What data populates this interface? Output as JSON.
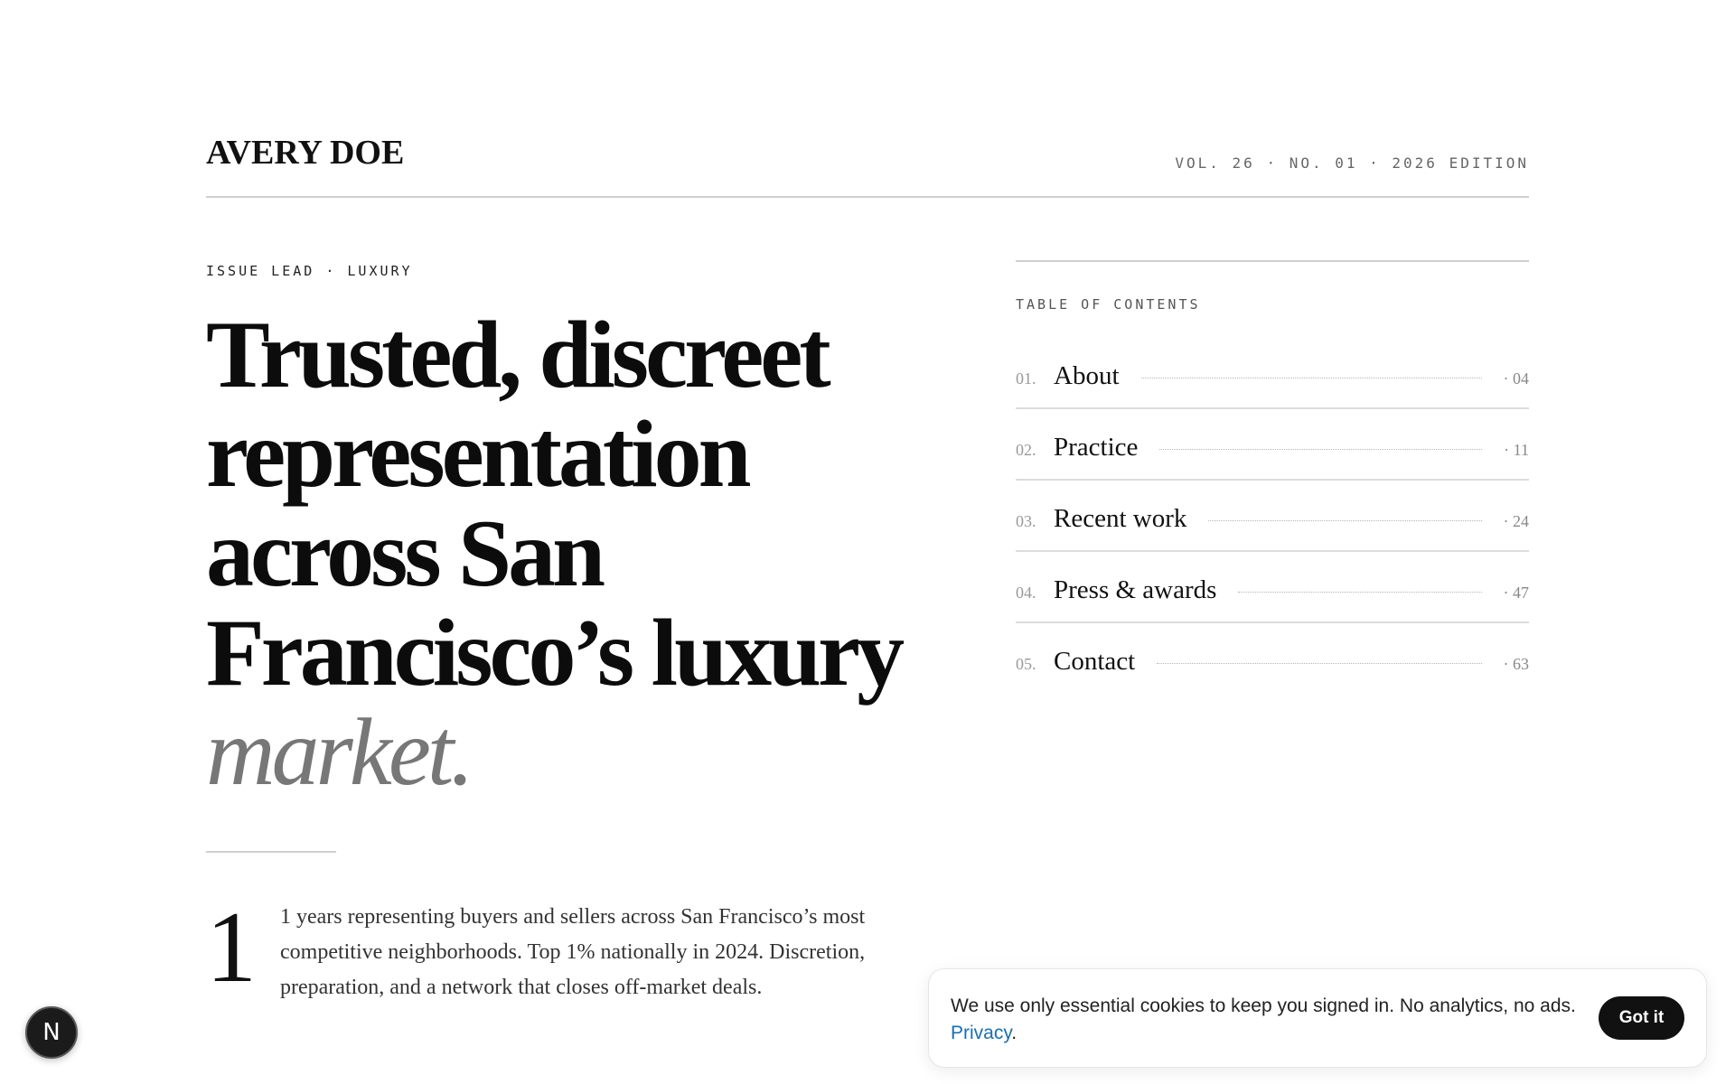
{
  "header": {
    "brand": "AVERY DOE",
    "edition": "VOL. 26 · NO. 01 · 2026 EDITION"
  },
  "hero": {
    "kicker": "ISSUE LEAD · LUXURY",
    "headline_main": "Trusted, discreet representation across San Francisco’s luxury",
    "headline_accent": "market.",
    "dropcap": "1",
    "lede": "1 years representing buyers and sellers across San Francisco’s most competitive neighborhoods. Top 1% nationally in 2024. Discretion, preparation, and a network that closes off-market deals."
  },
  "toc": {
    "label": "TABLE OF CONTENTS",
    "items": [
      {
        "num": "01.",
        "title": "About",
        "page": "· 04"
      },
      {
        "num": "02.",
        "title": "Practice",
        "page": "· 11"
      },
      {
        "num": "03.",
        "title": "Recent work",
        "page": "· 24"
      },
      {
        "num": "04.",
        "title": "Press & awards",
        "page": "· 47"
      },
      {
        "num": "05.",
        "title": "Contact",
        "page": "· 63"
      }
    ]
  },
  "cookie": {
    "text": "We use only essential cookies to keep you signed in. No analytics, no ads.",
    "link": "Privacy",
    "link_suffix": ".",
    "button": "Got it"
  },
  "badge": {
    "label": "N",
    "icon": "nextjs-logo-icon"
  },
  "colors": {
    "accent_gray": "#777777",
    "link_blue": "#1a6fb0",
    "button_bg": "#111111"
  }
}
